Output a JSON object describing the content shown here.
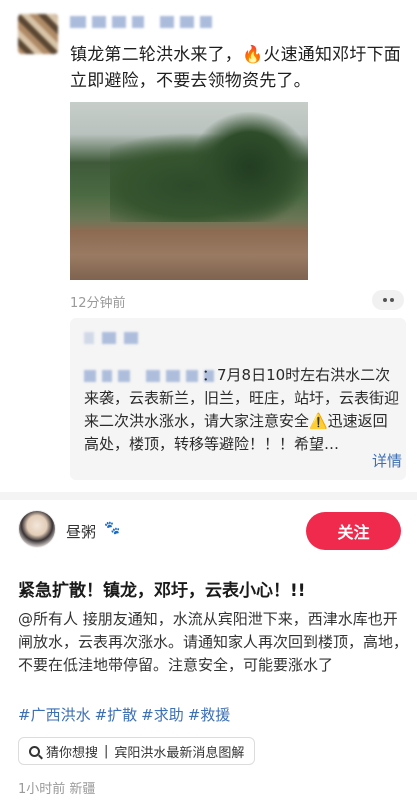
{
  "post": {
    "text": "镇龙第二轮洪水来了，🔥火速通知邓圩下面立即避险，不要去领物资先了。",
    "time": "12分钟前"
  },
  "quote": {
    "text": "：7月8日10时左右洪水二次来袭，云表新兰，旧兰，旺庄，站圩，云表街迎来二次洪水涨水，请大家注意安全⚠️迅速返回高处，楼顶，转移等避险！！！希望…",
    "detail_label": "详情"
  },
  "author": {
    "name": "昼粥",
    "follow_label": "关注"
  },
  "article": {
    "title": "紧急扩散！镇龙，邓圩，云表小心！!!",
    "body": "@所有人 接朋友通知，水流从宾阳泄下来，西津水库也开闸放水，云表再次涨水。请通知家人再次回到楼顶，高地，不要在低洼地带停留。注意安全，可能要涨水了",
    "tags": [
      "#广西洪水",
      "#扩散",
      "#求助",
      "#救援"
    ]
  },
  "search": {
    "label": "猜你想搜",
    "query": "宾阳洪水最新消息图解"
  },
  "meta": {
    "time": "1小时前",
    "location": "新疆"
  },
  "icons": {
    "more": "more-dots-icon",
    "paw": "paw-icon",
    "search": "search-icon"
  },
  "colors": {
    "follow": "#ef2a4d",
    "link": "#3d6fb5"
  }
}
